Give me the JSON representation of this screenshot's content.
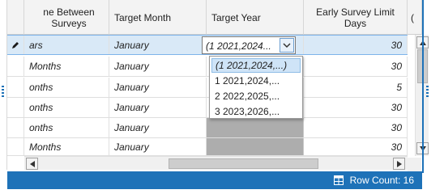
{
  "columns": {
    "col1": "ne Between Surveys",
    "col2": "Target Month",
    "col3": "Target Year",
    "col4": "Early Survey Limit Days",
    "col5": "("
  },
  "rows": [
    {
      "c1": "ars",
      "c2": "January",
      "c4": "30"
    },
    {
      "c1": "Months",
      "c2": "January",
      "c4": "30"
    },
    {
      "c1": "onths",
      "c2": "January",
      "c4": "5"
    },
    {
      "c1": "onths",
      "c2": "January",
      "c4": "30"
    },
    {
      "c1": "onths",
      "c2": "January",
      "c4": "30"
    },
    {
      "c1": "Months",
      "c2": "January",
      "c4": "30"
    }
  ],
  "combo": {
    "value": "(1   2021,2024..."
  },
  "dropdown": {
    "items": [
      "(1   2021,2024,...)",
      "1   2021,2024,...",
      "2   2022,2025,...",
      "3   2023,2026,..."
    ]
  },
  "status": {
    "row_count": "Row Count: 16"
  },
  "colors": {
    "accent": "#1e72b8",
    "selected_row": "#d9e9f7",
    "empty_cell": "#adadad"
  },
  "icons": {
    "edit_row": "pencil-icon",
    "dropdown": "chevron-down-icon",
    "row_count": "grid-icon"
  }
}
